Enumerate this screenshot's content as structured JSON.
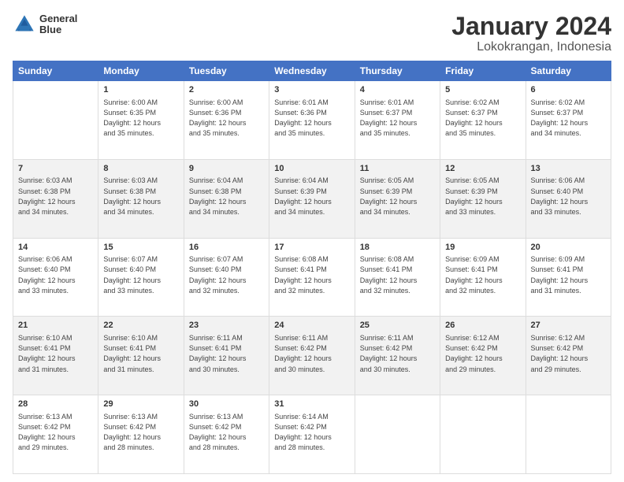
{
  "header": {
    "logo_line1": "General",
    "logo_line2": "Blue",
    "title": "January 2024",
    "subtitle": "Lokokrangan, Indonesia"
  },
  "days_of_week": [
    "Sunday",
    "Monday",
    "Tuesday",
    "Wednesday",
    "Thursday",
    "Friday",
    "Saturday"
  ],
  "weeks": [
    [
      {
        "day": "",
        "info": ""
      },
      {
        "day": "1",
        "info": "Sunrise: 6:00 AM\nSunset: 6:35 PM\nDaylight: 12 hours\nand 35 minutes."
      },
      {
        "day": "2",
        "info": "Sunrise: 6:00 AM\nSunset: 6:36 PM\nDaylight: 12 hours\nand 35 minutes."
      },
      {
        "day": "3",
        "info": "Sunrise: 6:01 AM\nSunset: 6:36 PM\nDaylight: 12 hours\nand 35 minutes."
      },
      {
        "day": "4",
        "info": "Sunrise: 6:01 AM\nSunset: 6:37 PM\nDaylight: 12 hours\nand 35 minutes."
      },
      {
        "day": "5",
        "info": "Sunrise: 6:02 AM\nSunset: 6:37 PM\nDaylight: 12 hours\nand 35 minutes."
      },
      {
        "day": "6",
        "info": "Sunrise: 6:02 AM\nSunset: 6:37 PM\nDaylight: 12 hours\nand 34 minutes."
      }
    ],
    [
      {
        "day": "7",
        "info": "Sunrise: 6:03 AM\nSunset: 6:38 PM\nDaylight: 12 hours\nand 34 minutes."
      },
      {
        "day": "8",
        "info": "Sunrise: 6:03 AM\nSunset: 6:38 PM\nDaylight: 12 hours\nand 34 minutes."
      },
      {
        "day": "9",
        "info": "Sunrise: 6:04 AM\nSunset: 6:38 PM\nDaylight: 12 hours\nand 34 minutes."
      },
      {
        "day": "10",
        "info": "Sunrise: 6:04 AM\nSunset: 6:39 PM\nDaylight: 12 hours\nand 34 minutes."
      },
      {
        "day": "11",
        "info": "Sunrise: 6:05 AM\nSunset: 6:39 PM\nDaylight: 12 hours\nand 34 minutes."
      },
      {
        "day": "12",
        "info": "Sunrise: 6:05 AM\nSunset: 6:39 PM\nDaylight: 12 hours\nand 33 minutes."
      },
      {
        "day": "13",
        "info": "Sunrise: 6:06 AM\nSunset: 6:40 PM\nDaylight: 12 hours\nand 33 minutes."
      }
    ],
    [
      {
        "day": "14",
        "info": "Sunrise: 6:06 AM\nSunset: 6:40 PM\nDaylight: 12 hours\nand 33 minutes."
      },
      {
        "day": "15",
        "info": "Sunrise: 6:07 AM\nSunset: 6:40 PM\nDaylight: 12 hours\nand 33 minutes."
      },
      {
        "day": "16",
        "info": "Sunrise: 6:07 AM\nSunset: 6:40 PM\nDaylight: 12 hours\nand 32 minutes."
      },
      {
        "day": "17",
        "info": "Sunrise: 6:08 AM\nSunset: 6:41 PM\nDaylight: 12 hours\nand 32 minutes."
      },
      {
        "day": "18",
        "info": "Sunrise: 6:08 AM\nSunset: 6:41 PM\nDaylight: 12 hours\nand 32 minutes."
      },
      {
        "day": "19",
        "info": "Sunrise: 6:09 AM\nSunset: 6:41 PM\nDaylight: 12 hours\nand 32 minutes."
      },
      {
        "day": "20",
        "info": "Sunrise: 6:09 AM\nSunset: 6:41 PM\nDaylight: 12 hours\nand 31 minutes."
      }
    ],
    [
      {
        "day": "21",
        "info": "Sunrise: 6:10 AM\nSunset: 6:41 PM\nDaylight: 12 hours\nand 31 minutes."
      },
      {
        "day": "22",
        "info": "Sunrise: 6:10 AM\nSunset: 6:41 PM\nDaylight: 12 hours\nand 31 minutes."
      },
      {
        "day": "23",
        "info": "Sunrise: 6:11 AM\nSunset: 6:41 PM\nDaylight: 12 hours\nand 30 minutes."
      },
      {
        "day": "24",
        "info": "Sunrise: 6:11 AM\nSunset: 6:42 PM\nDaylight: 12 hours\nand 30 minutes."
      },
      {
        "day": "25",
        "info": "Sunrise: 6:11 AM\nSunset: 6:42 PM\nDaylight: 12 hours\nand 30 minutes."
      },
      {
        "day": "26",
        "info": "Sunrise: 6:12 AM\nSunset: 6:42 PM\nDaylight: 12 hours\nand 29 minutes."
      },
      {
        "day": "27",
        "info": "Sunrise: 6:12 AM\nSunset: 6:42 PM\nDaylight: 12 hours\nand 29 minutes."
      }
    ],
    [
      {
        "day": "28",
        "info": "Sunrise: 6:13 AM\nSunset: 6:42 PM\nDaylight: 12 hours\nand 29 minutes."
      },
      {
        "day": "29",
        "info": "Sunrise: 6:13 AM\nSunset: 6:42 PM\nDaylight: 12 hours\nand 28 minutes."
      },
      {
        "day": "30",
        "info": "Sunrise: 6:13 AM\nSunset: 6:42 PM\nDaylight: 12 hours\nand 28 minutes."
      },
      {
        "day": "31",
        "info": "Sunrise: 6:14 AM\nSunset: 6:42 PM\nDaylight: 12 hours\nand 28 minutes."
      },
      {
        "day": "",
        "info": ""
      },
      {
        "day": "",
        "info": ""
      },
      {
        "day": "",
        "info": ""
      }
    ]
  ]
}
